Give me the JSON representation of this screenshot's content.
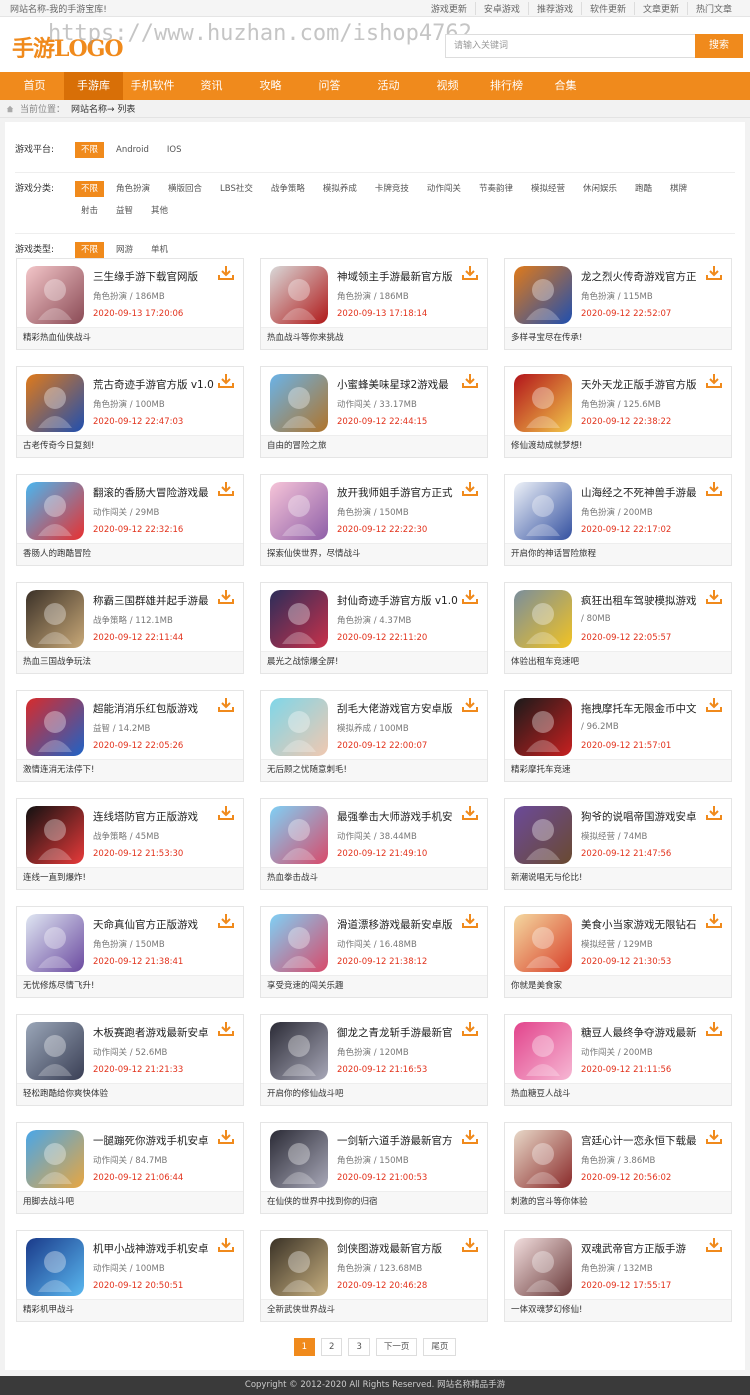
{
  "topbar": {
    "slogan": "网站名称-我的手游宝库!",
    "links": [
      "游戏更新",
      "安卓游戏",
      "推荐游戏",
      "软件更新",
      "文章更新",
      "热门文章"
    ]
  },
  "header": {
    "logo": "手游LOGO",
    "watermark": "https://www.huzhan.com/ishop4762",
    "search_placeholder": "请输入关键词",
    "search_button": "搜索"
  },
  "nav": {
    "items": [
      "首页",
      "手游库",
      "手机软件",
      "资讯",
      "攻略",
      "问答",
      "活动",
      "视频",
      "排行榜",
      "合集"
    ],
    "active_index": 1
  },
  "breadcrumb": {
    "prefix": "当前位置：",
    "path": "网站名称→ 列表"
  },
  "filters": [
    {
      "label": "游戏平台:",
      "options": [
        "不限",
        "Android",
        "IOS"
      ],
      "active": 0
    },
    {
      "label": "游戏分类:",
      "options": [
        "不限",
        "角色扮演",
        "横版回合",
        "LBS社交",
        "战争策略",
        "模拟养成",
        "卡牌竞技",
        "动作闯关",
        "节奏韵律",
        "模拟经营",
        "休闲娱乐",
        "跑酷",
        "棋牌",
        "射击",
        "益智",
        "其他"
      ],
      "active": 0
    },
    {
      "label": "游戏类型:",
      "options": [
        "不限",
        "网游",
        "单机"
      ],
      "active": 0
    }
  ],
  "games": [
    {
      "title": "三生缘手游下载官网版",
      "category": "角色扮演",
      "size": "186MB",
      "date": "2020-09-13 17:20:06",
      "desc": "精彩热血仙侠战斗",
      "icon": "female-warrior-icon",
      "c1": "#f3c6c9",
      "c2": "#8a4a55"
    },
    {
      "title": "神域领主手游最新官方版",
      "category": "角色扮演",
      "size": "186MB",
      "date": "2020-09-13 17:18:14",
      "desc": "热血战斗等你来挑战",
      "icon": "assassin-icon",
      "c1": "#d9d9d9",
      "c2": "#b01818"
    },
    {
      "title": "龙之烈火传奇游戏官方正",
      "category": "角色扮演",
      "size": "115MB",
      "date": "2020-09-12 22:52:07",
      "desc": "多样寻宝尽在传承!",
      "icon": "dragon-orb-icon",
      "c1": "#e07a1a",
      "c2": "#1f4fb0"
    },
    {
      "title": "荒古奇迹手游官方版 v1.0",
      "category": "角色扮演",
      "size": "100MB",
      "date": "2020-09-12 22:47:03",
      "desc": "古老传奇今日复刻!",
      "icon": "dragon-orb-icon",
      "c1": "#e07a1a",
      "c2": "#1f4fb0"
    },
    {
      "title": "小蜜蜂美味星球2游戏最",
      "category": "动作闯关",
      "size": "33.17MB",
      "date": "2020-09-12 22:44:15",
      "desc": "自由的冒险之旅",
      "icon": "bear-planet-icon",
      "c1": "#6ab3e8",
      "c2": "#b0742a"
    },
    {
      "title": "天外天龙正版手游官方版",
      "category": "角色扮演",
      "size": "125.6MB",
      "date": "2020-09-12 22:38:22",
      "desc": "修仙渡劫成就梦想!",
      "icon": "dragon-calligraphy-icon",
      "c1": "#b2141b",
      "c2": "#f2c84a"
    },
    {
      "title": "翻滚的香肠大冒险游戏最",
      "category": "动作闯关",
      "size": "29MB",
      "date": "2020-09-12 22:32:16",
      "desc": "香肠人的跑酷冒险",
      "icon": "sausage-icon",
      "c1": "#49b6f0",
      "c2": "#e83030"
    },
    {
      "title": "放开我师姐手游官方正式",
      "category": "角色扮演",
      "size": "150MB",
      "date": "2020-09-12 22:22:30",
      "desc": "探索仙侠世界，尽情战斗",
      "icon": "fairy-girl-icon",
      "c1": "#f6c4d8",
      "c2": "#8e5fa8"
    },
    {
      "title": "山海经之不死神兽手游最",
      "category": "角色扮演",
      "size": "200MB",
      "date": "2020-09-12 22:17:02",
      "desc": "开启你的神话冒险旅程",
      "icon": "shanhai-calligraphy-icon",
      "c1": "#eef2f8",
      "c2": "#3350a0"
    },
    {
      "title": "称霸三国群雄并起手游最",
      "category": "战争策略",
      "size": "112.1MB",
      "date": "2020-09-12 22:11:44",
      "desc": "热血三国战争玩法",
      "icon": "three-kingdoms-icon",
      "c1": "#3b3128",
      "c2": "#c9a978"
    },
    {
      "title": "封仙奇迹手游官方版 v1.0",
      "category": "角色扮演",
      "size": "4.37MB",
      "date": "2020-09-12 22:11:20",
      "desc": "晨光之战惊爆全屏!",
      "icon": "warrior-girl-icon",
      "c1": "#2c2e5a",
      "c2": "#c9304a"
    },
    {
      "title": "疯狂出租车驾驶模拟游戏",
      "category": "",
      "size": "80MB",
      "date": "2020-09-12 22:05:57",
      "desc": "体验出租车竞速吧",
      "icon": "taxi-icon",
      "c1": "#7a8e9c",
      "c2": "#f2c322"
    },
    {
      "title": "超能消消乐红包版游戏",
      "category": "益智",
      "size": "14.2MB",
      "date": "2020-09-12 22:05:26",
      "desc": "激情连消无法停下!",
      "icon": "super-blocks-icon",
      "c1": "#d82b2b",
      "c2": "#1e63c7"
    },
    {
      "title": "刮毛大佬游戏官方安卓版",
      "category": "模拟养成",
      "size": "100MB",
      "date": "2020-09-12 22:00:07",
      "desc": "无后顾之忧随意刺毛!",
      "icon": "shaving-leg-icon",
      "c1": "#7fd6e8",
      "c2": "#f1c8b0"
    },
    {
      "title": "拖拽摩托车无限金币中文",
      "category": "",
      "size": "96.2MB",
      "date": "2020-09-12 21:57:01",
      "desc": "精彩摩托车竞速",
      "icon": "drag-bike-icon",
      "c1": "#1a1a1a",
      "c2": "#c82020"
    },
    {
      "title": "连线塔防官方正版游戏",
      "category": "战争策略",
      "size": "45MB",
      "date": "2020-09-12 21:53:30",
      "desc": "连线一直到爆炸!",
      "icon": "line-tower-icon",
      "c1": "#111111",
      "c2": "#e83a3a"
    },
    {
      "title": "最强拳击大师游戏手机安",
      "category": "动作闯关",
      "size": "38.44MB",
      "date": "2020-09-12 21:49:10",
      "desc": "热血拳击战斗",
      "icon": "toy-car-icon",
      "c1": "#7fd0f5",
      "c2": "#d84a6a"
    },
    {
      "title": "狗爷的说唱帝国游戏安卓",
      "category": "模拟经营",
      "size": "74MB",
      "date": "2020-09-12 21:47:56",
      "desc": "新潮说唱无与伦比!",
      "icon": "rapper-icon",
      "c1": "#6b4a9a",
      "c2": "#6a4a30"
    },
    {
      "title": "天命真仙官方正版游戏",
      "category": "角色扮演",
      "size": "150MB",
      "date": "2020-09-12 21:38:41",
      "desc": "无忧修炼尽情飞升!",
      "icon": "fairy-girl-icon",
      "c1": "#dfe6f2",
      "c2": "#6b4aa0"
    },
    {
      "title": "滑道漂移游戏最新安卓版",
      "category": "动作闯关",
      "size": "16.48MB",
      "date": "2020-09-12 21:38:12",
      "desc": "享受竞速的闯关乐趣",
      "icon": "toy-car-icon",
      "c1": "#7fd0f5",
      "c2": "#d84a6a"
    },
    {
      "title": "美食小当家游戏无限钻石",
      "category": "模拟经营",
      "size": "129MB",
      "date": "2020-09-12 21:30:53",
      "desc": "你就是美食家",
      "icon": "noodle-bowl-icon",
      "c1": "#f4d8a0",
      "c2": "#d8402a"
    },
    {
      "title": "木板赛跑者游戏最新安卓",
      "category": "动作闯关",
      "size": "52.6MB",
      "date": "2020-09-12 21:21:33",
      "desc": "轻松跑酷给你爽快体验",
      "icon": "runner-icon",
      "c1": "#9aa6b8",
      "c2": "#3a3f55"
    },
    {
      "title": "御龙之青龙斩手游最新官",
      "category": "角色扮演",
      "size": "120MB",
      "date": "2020-09-12 21:16:53",
      "desc": "开启你的修仙战斗吧",
      "icon": "swordsman-icon",
      "c1": "#2b2b36",
      "c2": "#a8a8b8"
    },
    {
      "title": "糖豆人最终争夺游戏最新",
      "category": "动作闯关",
      "size": "200MB",
      "date": "2020-09-12 21:11:56",
      "desc": "热血糖豆人战斗",
      "icon": "fall-guy-icon",
      "c1": "#e2448c",
      "c2": "#f6b8d4"
    },
    {
      "title": "一腿蹦死你游戏手机安卓",
      "category": "动作闯关",
      "size": "84.7MB",
      "date": "2020-09-12 21:06:44",
      "desc": "用脚去战斗吧",
      "icon": "viking-icon",
      "c1": "#49a6e8",
      "c2": "#e8a640"
    },
    {
      "title": "一剑斩六道手游最新官方",
      "category": "角色扮演",
      "size": "150MB",
      "date": "2020-09-12 21:00:53",
      "desc": "在仙侠的世界中找到你的归宿",
      "icon": "swordsman-icon",
      "c1": "#2b2b36",
      "c2": "#a8a8b8"
    },
    {
      "title": "宫廷心计一恋永恒下载最",
      "category": "角色扮演",
      "size": "3.86MB",
      "date": "2020-09-12 20:56:02",
      "desc": "刺激的宫斗等你体验",
      "icon": "palace-lady-icon",
      "c1": "#e8d8c8",
      "c2": "#8a2a2a"
    },
    {
      "title": "机甲小战神游戏手机安卓",
      "category": "动作闯关",
      "size": "100MB",
      "date": "2020-09-12 20:50:51",
      "desc": "精彩机甲战斗",
      "icon": "mecha-icon",
      "c1": "#1a3a8a",
      "c2": "#5ab8f0"
    },
    {
      "title": "剑侠图游戏最新官方版",
      "category": "角色扮演",
      "size": "123.68MB",
      "date": "2020-09-12 20:46:28",
      "desc": "全新武侠世界战斗",
      "icon": "jianxia-calligraphy-icon",
      "c1": "#3a3226",
      "c2": "#c8b080"
    },
    {
      "title": "双魂武帝官方正版手游",
      "category": "角色扮演",
      "size": "132MB",
      "date": "2020-09-12 17:55:17",
      "desc": "一体双魂梦幻修仙!",
      "icon": "fairy-girl-icon",
      "c1": "#f2dede",
      "c2": "#6a3a3a"
    }
  ],
  "pager": {
    "pages": [
      "1",
      "2",
      "3"
    ],
    "next": "下一页",
    "last": "尾页",
    "active": 0
  },
  "footer": {
    "text": "Copyright © 2012-2020 All Rights Reserved. 网站名称精品手游"
  },
  "colors": {
    "accent": "#f08a1c",
    "nav_active": "#d86f07",
    "date_red": "#e2321c"
  }
}
